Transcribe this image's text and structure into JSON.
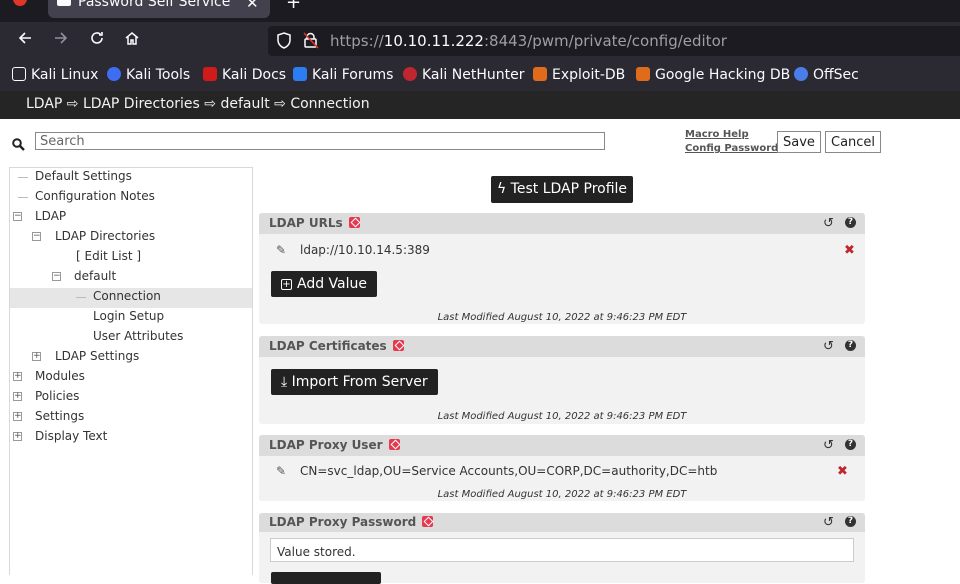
{
  "browser": {
    "tab_title": "Password Self Service",
    "tab_close": "✕",
    "new_tab": "+",
    "url_scheme": "https://",
    "url_host": "10.10.11.222",
    "url_rest": ":8443/pwm/private/config/editor"
  },
  "bookmarks": [
    {
      "label": "Kali Linux",
      "color": "#2b2a33"
    },
    {
      "label": "Kali Tools",
      "color": "#3d6df2"
    },
    {
      "label": "Kali Docs",
      "color": "#d11b1b"
    },
    {
      "label": "Kali Forums",
      "color": "#2d7df2"
    },
    {
      "label": "Kali NetHunter",
      "color": "#c0262d"
    },
    {
      "label": "Exploit-DB",
      "color": "#e06b1a"
    },
    {
      "label": "Google Hacking DB",
      "color": "#e06b1a"
    },
    {
      "label": "OffSec",
      "color": "#4a7de8"
    }
  ],
  "breadcrumb": "LDAP ⇨ LDAP Directories ⇨ default ⇨ Connection",
  "search": {
    "placeholder": "Search"
  },
  "header_links": {
    "macro_help": "Macro Help",
    "config_password": "Config Password"
  },
  "buttons": {
    "save": "Save",
    "cancel": "Cancel",
    "test_ldap": "Test LDAP Profile",
    "add_value": "Add Value",
    "import_from_server": "Import From Server"
  },
  "tree": [
    {
      "label": "Default Settings"
    },
    {
      "label": "Configuration Notes"
    },
    {
      "label": "LDAP",
      "toggle": "−"
    },
    {
      "label": "LDAP Directories",
      "toggle": "−"
    },
    {
      "label": "[ Edit List ]"
    },
    {
      "label": "default",
      "toggle": "−"
    },
    {
      "label": "Connection",
      "selected": true
    },
    {
      "label": "Login Setup"
    },
    {
      "label": "User Attributes"
    },
    {
      "label": "LDAP Settings",
      "toggle": "+"
    },
    {
      "label": "Modules",
      "toggle": "+"
    },
    {
      "label": "Policies",
      "toggle": "+"
    },
    {
      "label": "Settings",
      "toggle": "+"
    },
    {
      "label": "Display Text",
      "toggle": "+"
    }
  ],
  "panels": {
    "ldap_urls": {
      "title": "LDAP URLs",
      "value": "ldap://10.10.14.5:389",
      "last_modified": "Last Modified August 10, 2022 at 9:46:23 PM EDT"
    },
    "ldap_certificates": {
      "title": "LDAP Certificates",
      "last_modified": "Last Modified August 10, 2022 at 9:46:23 PM EDT"
    },
    "ldap_proxy_user": {
      "title": "LDAP Proxy User",
      "value": "CN=svc_ldap,OU=Service Accounts,OU=CORP,DC=authority,DC=htb",
      "last_modified": "Last Modified August 10, 2022 at 9:46:23 PM EDT"
    },
    "ldap_proxy_password": {
      "title": "LDAP Proxy Password",
      "value": "Value stored."
    }
  }
}
